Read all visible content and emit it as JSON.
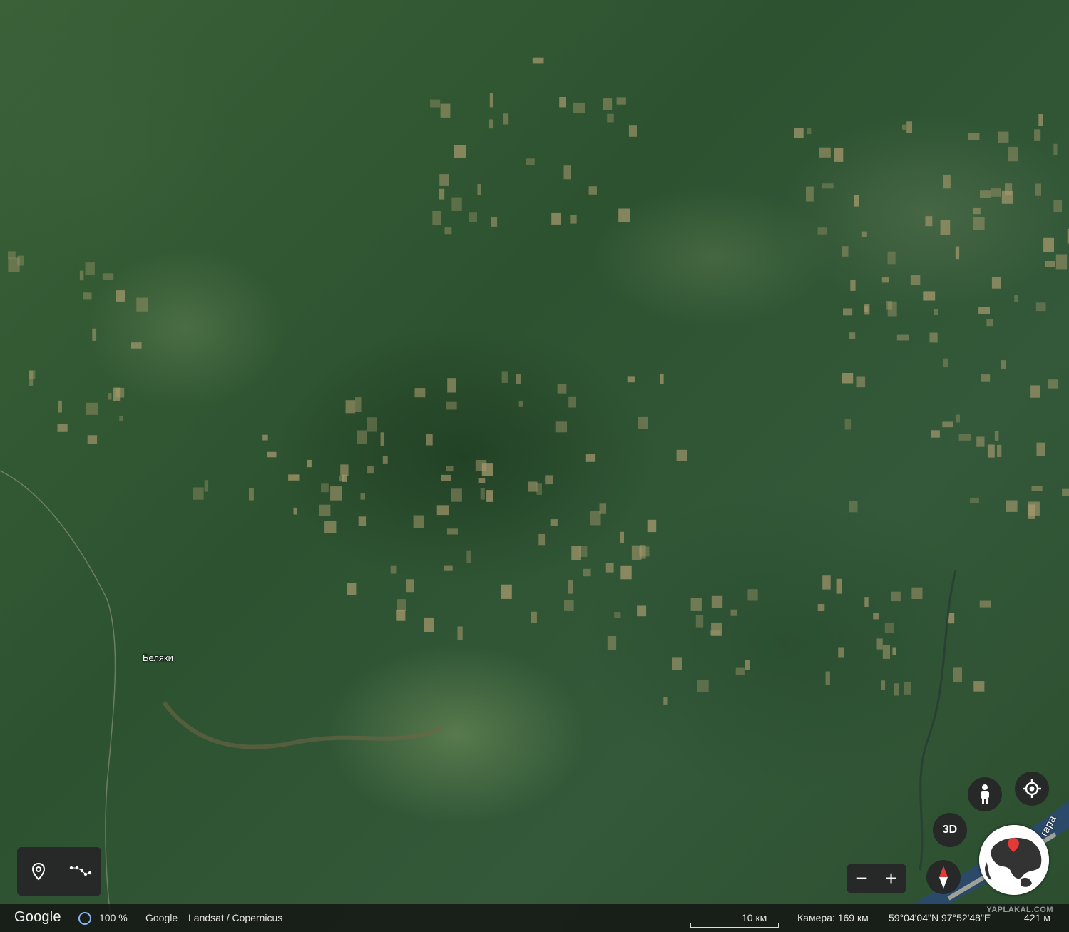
{
  "map": {
    "place_label": "Беляки",
    "river_label": "гара"
  },
  "tools": {
    "placemark": "placemark-icon",
    "path": "path-icon"
  },
  "controls": {
    "pegman": "pegman-icon",
    "my_location": "my-location-icon",
    "toggle_3d": "3D",
    "zoom_out": "−",
    "zoom_in": "+",
    "compass": "compass-icon",
    "globe": "globe-icon"
  },
  "status_bar": {
    "brand": "Google",
    "loading_percent": "100 %",
    "attribution_1": "Google",
    "attribution_2": "Landsat / Copernicus",
    "scale": "10 км",
    "camera": "Камера: 169 км",
    "coordinates": "59°04'04\"N 97°52'48\"E",
    "elevation": "421 м"
  },
  "watermark": "YAPLAKAL.COM",
  "colors": {
    "forest": "#2f5230",
    "clearing": "#a89a6e",
    "panel": "#262626",
    "river": "#2b4a6a"
  }
}
